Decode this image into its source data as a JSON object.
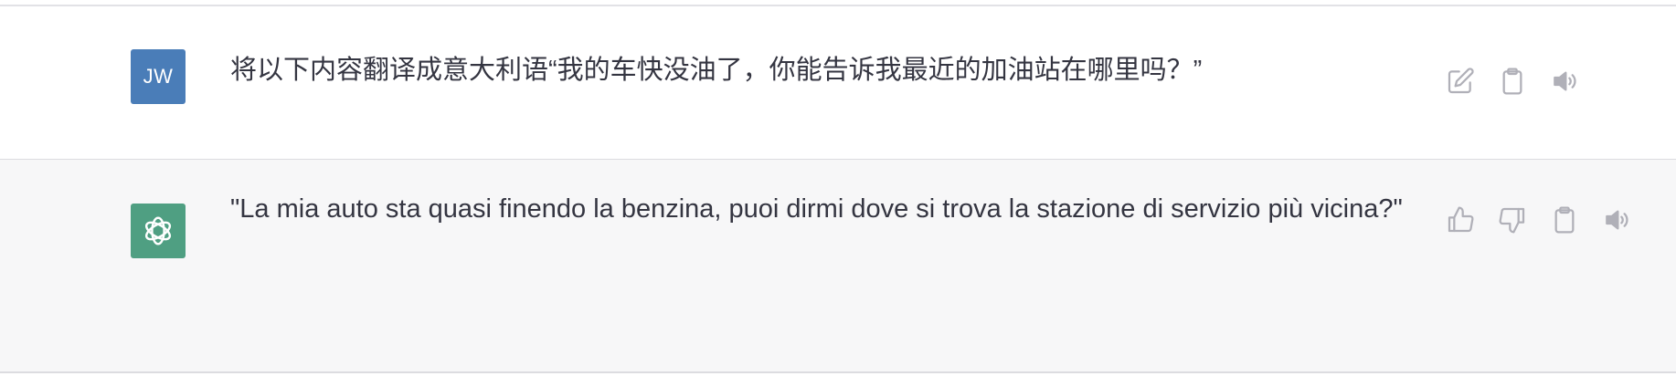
{
  "conversation": {
    "user_message": {
      "avatar_initials": "JW",
      "avatar_color": "#4a7db8",
      "text": "将以下内容翻译成意大利语“我的车快没油了，你能告诉我最近的加油站在哪里吗？”",
      "actions": [
        "edit-icon",
        "clipboard-icon",
        "speaker-icon"
      ]
    },
    "assistant_message": {
      "avatar_icon": "openai-logo-icon",
      "avatar_color": "#4f9f82",
      "text": "\"La mia auto sta quasi finendo la benzina, puoi dirmi dove si trova la stazione di servizio più vicina?\"",
      "actions": [
        "thumbs-up-icon",
        "thumbs-down-icon",
        "clipboard-icon",
        "speaker-icon"
      ]
    }
  },
  "colors": {
    "text": "#343541",
    "icon": "#b0b0b8",
    "assistant_bg": "#f7f7f8"
  }
}
